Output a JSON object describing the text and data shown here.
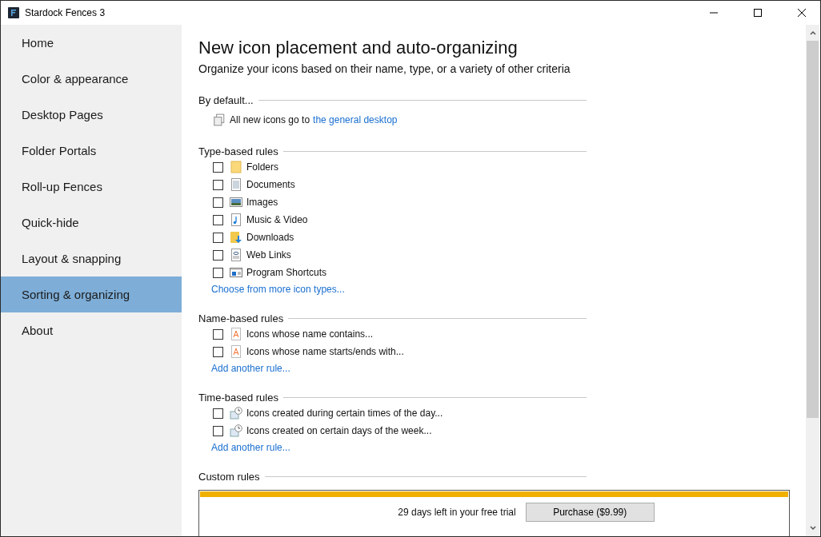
{
  "window": {
    "title": "Stardock Fences 3"
  },
  "sidebar": {
    "items": [
      {
        "label": "Home",
        "selected": false
      },
      {
        "label": "Color & appearance",
        "selected": false
      },
      {
        "label": "Desktop Pages",
        "selected": false
      },
      {
        "label": "Folder Portals",
        "selected": false
      },
      {
        "label": "Roll-up Fences",
        "selected": false
      },
      {
        "label": "Quick-hide",
        "selected": false
      },
      {
        "label": "Layout & snapping",
        "selected": false
      },
      {
        "label": "Sorting & organizing",
        "selected": true
      },
      {
        "label": "About",
        "selected": false
      }
    ]
  },
  "heading": "New icon placement and auto-organizing",
  "subheading": "Organize your icons based on their name, type, or a variety of other criteria",
  "sections": [
    {
      "title": "By default...",
      "default": {
        "text": "All new icons go to",
        "link": "the general desktop"
      }
    },
    {
      "title": "Type-based rules",
      "rules": [
        {
          "label": "Folders",
          "checked": false,
          "kind": "folder"
        },
        {
          "label": "Documents",
          "checked": false,
          "kind": "document"
        },
        {
          "label": "Images",
          "checked": false,
          "kind": "image"
        },
        {
          "label": "Music & Video",
          "checked": false,
          "kind": "music"
        },
        {
          "label": "Downloads",
          "checked": false,
          "kind": "downloads"
        },
        {
          "label": "Web Links",
          "checked": false,
          "kind": "weblink"
        },
        {
          "label": "Program Shortcuts",
          "checked": false,
          "kind": "shortcut"
        }
      ],
      "link": "Choose from more icon types..."
    },
    {
      "title": "Name-based rules",
      "rules": [
        {
          "label": "Icons whose name contains...",
          "checked": false,
          "kind": "text"
        },
        {
          "label": "Icons whose name starts/ends with...",
          "checked": false,
          "kind": "text"
        }
      ],
      "link": "Add another rule..."
    },
    {
      "title": "Time-based rules",
      "rules": [
        {
          "label": "Icons created during certain times of the day...",
          "checked": false,
          "kind": "clock"
        },
        {
          "label": "Icons created on certain days of the week...",
          "checked": false,
          "kind": "clock"
        }
      ],
      "link": "Add another rule..."
    },
    {
      "title": "Custom rules"
    }
  ],
  "trial": {
    "text": "29 days left in your free trial",
    "button": "Purchase ($9.99)"
  }
}
